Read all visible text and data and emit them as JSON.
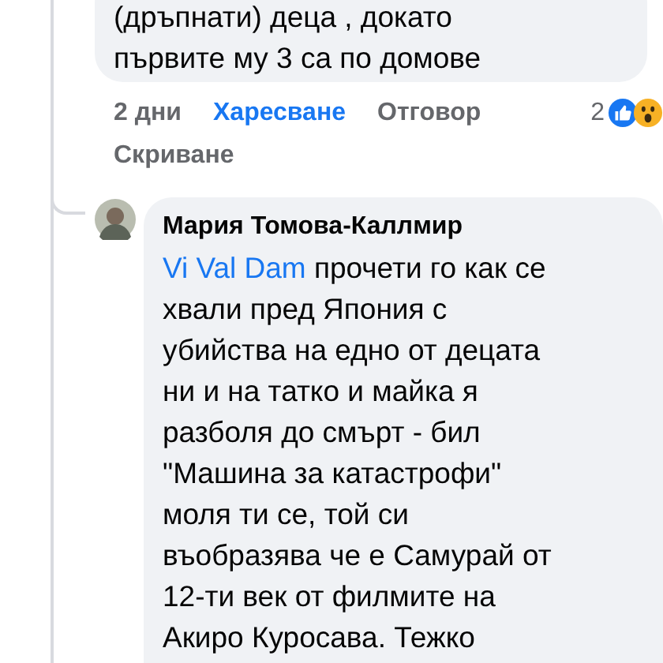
{
  "comments": [
    {
      "lines": [
        "(дръпнати) деца , докато",
        "първите му 3 са по домове"
      ],
      "time": "2 дни",
      "like_label": "Харесване",
      "liked": true,
      "reply_label": "Отговор",
      "reaction_count": "2",
      "hide_label": "Скриване"
    },
    {
      "author": "Мария Томова-Каллмир",
      "mention": "Vi Val Dam",
      "lines": [
        " прочети го как се",
        "хвали пред Япония с",
        "убийства на едно от децата",
        "ни и на татко и майка я",
        "разболя до смърт - бил",
        "\"Машина за катастрофи\"",
        "моля ти се, той си",
        "въобразява че е Самурай от",
        "12-ти век от филмите на",
        "Акиро Куросава. Тежко"
      ]
    }
  ]
}
